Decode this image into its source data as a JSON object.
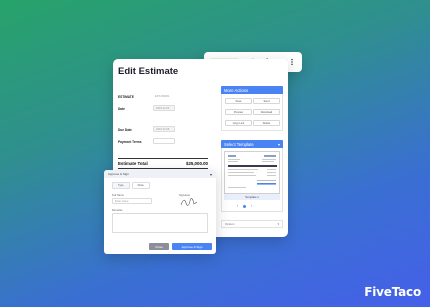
{
  "status": {
    "badge": "Approved",
    "icons": [
      "edit-icon",
      "send-icon",
      "view-icon",
      "more-icon"
    ]
  },
  "estimate": {
    "title": "Edit Estimate",
    "fields": {
      "estimate_label": "ESTIMATE",
      "estimate_value": "EST-000001",
      "date_label": "Date",
      "date_value": "2023-12-06",
      "due_label": "Due Date",
      "due_value": "2023-12-06",
      "terms_label": "Payment Terms"
    },
    "total_label": "Estimate Total",
    "total_value": "$25,000.00"
  },
  "more_actions": {
    "title": "More Actions",
    "buttons": [
      "Save",
      "Send",
      "Preview",
      "Download",
      "Copy Link",
      "Delete"
    ]
  },
  "template": {
    "title": "Select Template",
    "thumbnail_label": "Template 1",
    "option_label": "Options"
  },
  "approve_modal": {
    "title": "Approve & Sign",
    "tabs": [
      "Type",
      "Draw"
    ],
    "full_name_label": "Full Name",
    "full_name_placeholder": "Enter name",
    "signature_label": "Signature",
    "remarks_label": "Remarks",
    "close_label": "Close",
    "submit_label": "Approve & Sign"
  },
  "brand": {
    "name": "FiveTaco"
  },
  "colors": {
    "accent": "#4a84f4",
    "approved": "#23a354"
  }
}
